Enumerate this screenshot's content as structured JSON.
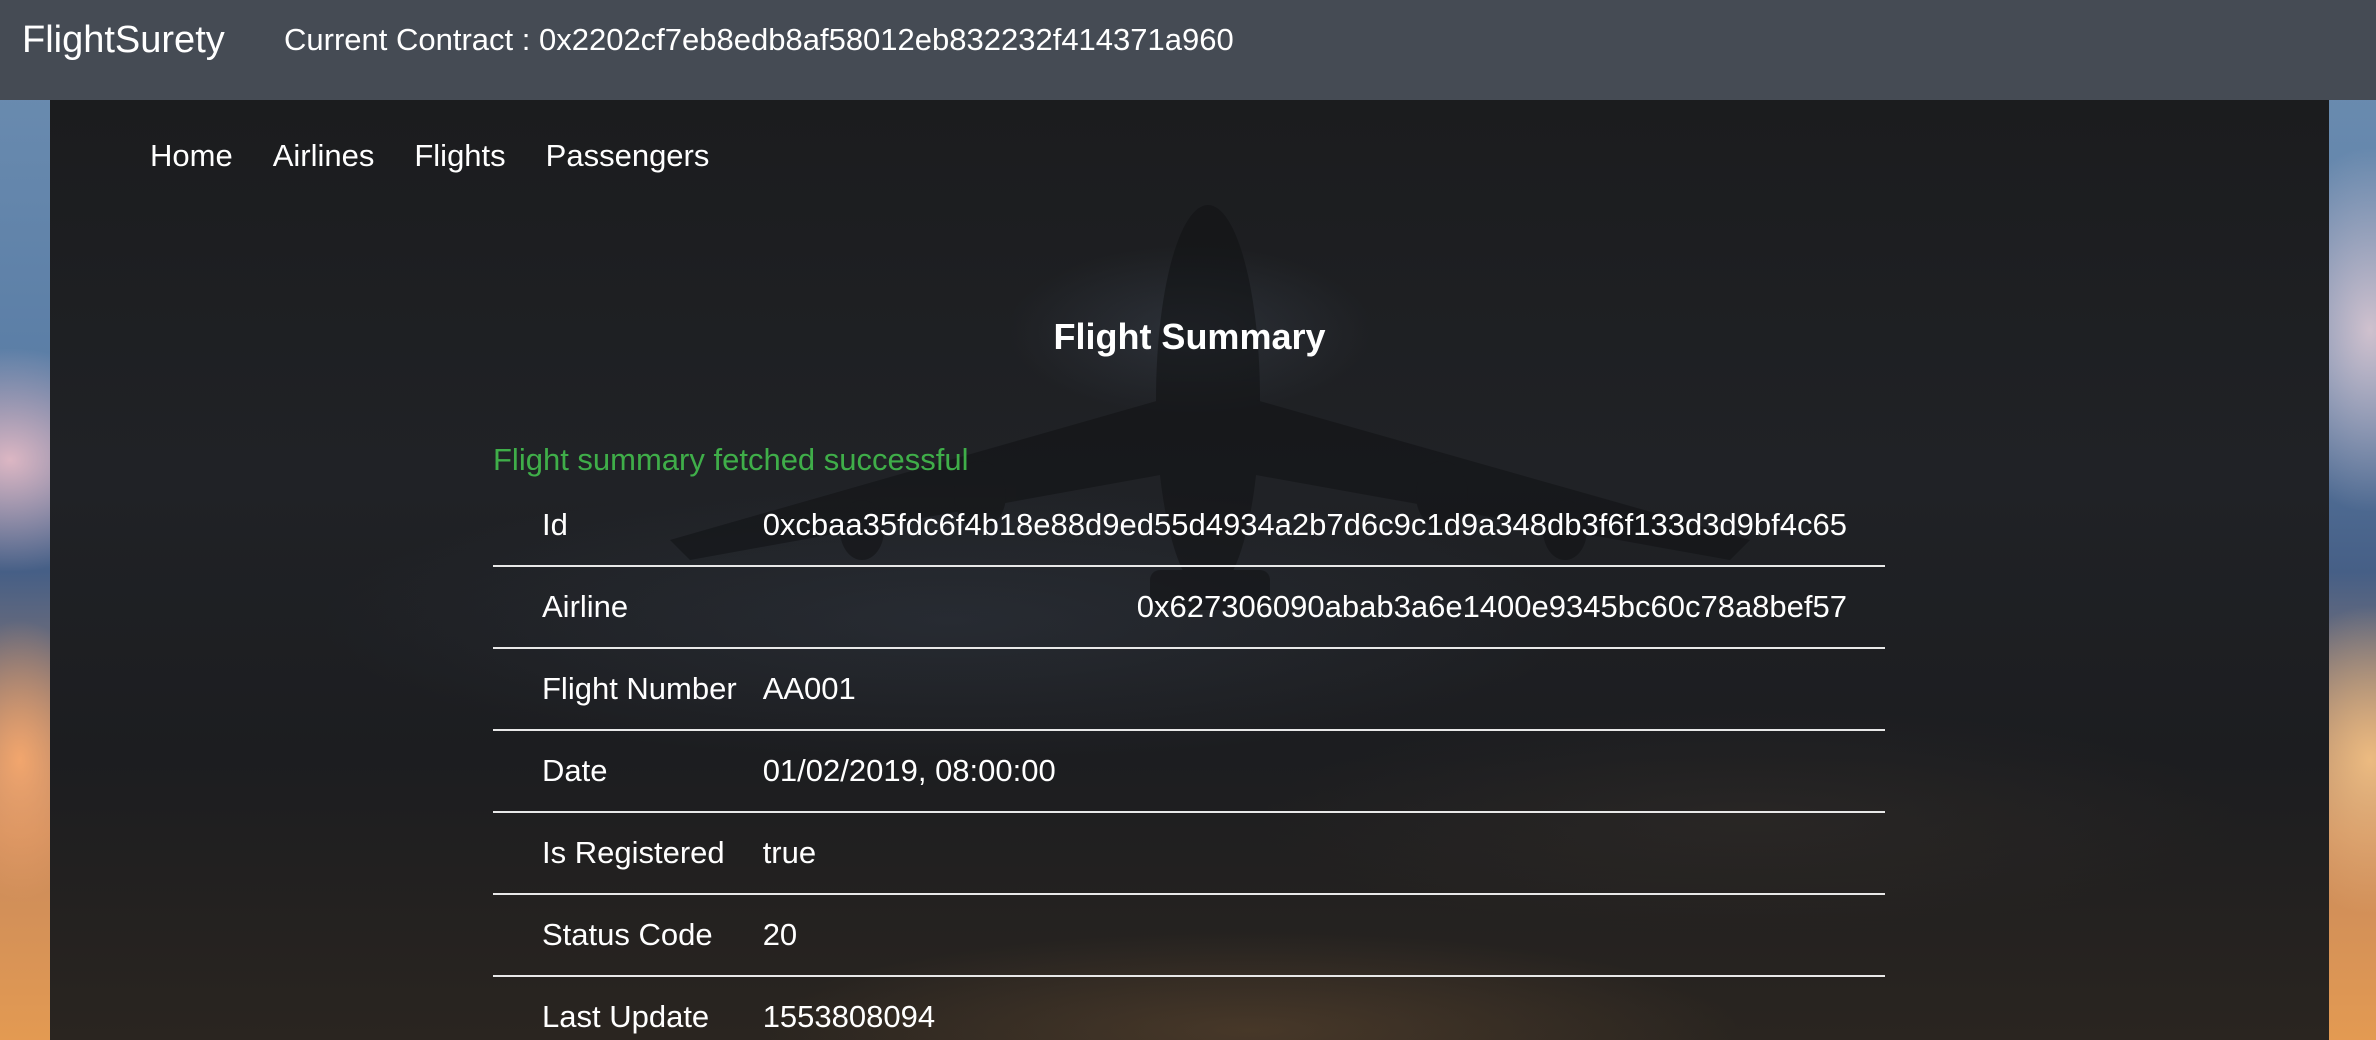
{
  "header": {
    "brand": "FlightSurety",
    "contract": "Current Contract : 0x2202cf7eb8edb8af58012eb832232f414371a960"
  },
  "nav": {
    "items": [
      {
        "label": "Home"
      },
      {
        "label": "Airlines"
      },
      {
        "label": "Flights"
      },
      {
        "label": "Passengers"
      }
    ]
  },
  "main": {
    "title": "Flight Summary",
    "status": "Flight summary fetched successful",
    "status_color": "#3fae49",
    "rows": [
      {
        "label": "Id",
        "value": "0xcbaa35fdc6f4b18e88d9ed55d4934a2b7d6c9c1d9a348db3f6f133d3d9bf4c65"
      },
      {
        "label": "Airline",
        "value": "0x627306090abab3a6e1400e9345bc60c78a8bef57"
      },
      {
        "label": "Flight Number",
        "value": "AA001"
      },
      {
        "label": "Date",
        "value": "01/02/2019, 08:00:00"
      },
      {
        "label": "Is Registered",
        "value": "true"
      },
      {
        "label": "Status Code",
        "value": "20"
      },
      {
        "label": "Last Update",
        "value": "1553808094"
      }
    ]
  },
  "colors": {
    "navbar": "#454b54",
    "panel": "#1c1d20",
    "text": "#ffffff",
    "divider": "#e8e8e8"
  }
}
